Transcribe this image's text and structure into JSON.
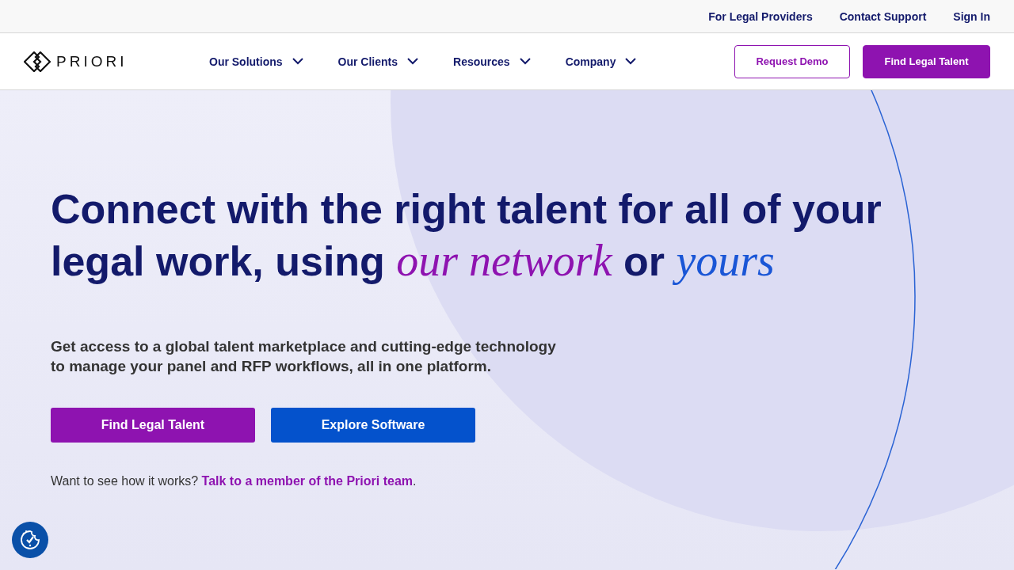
{
  "top_bar": {
    "links": [
      "For Legal Providers",
      "Contact Support",
      "Sign In"
    ]
  },
  "nav": {
    "logo": "PRIORI",
    "menu": [
      "Our Solutions",
      "Our Clients",
      "Resources",
      "Company"
    ],
    "buttons": [
      {
        "label": "Request Demo",
        "kind": "outline"
      },
      {
        "label": "Find Legal Talent",
        "kind": "filled"
      }
    ]
  },
  "hero": {
    "headline": [
      {
        "text": "Connect with the right talent for all of your legal work, using ",
        "kind": "plain"
      },
      {
        "text": "our network",
        "kind": "accent"
      },
      {
        "text": " or ",
        "kind": "plain"
      },
      {
        "text": "yours",
        "kind": "accent2"
      }
    ],
    "subtitle": "Get access to a global talent marketplace and cutting-edge technology to manage your panel and RFP workflows, all in one platform.",
    "buttons": [
      {
        "label": "Find Legal Talent",
        "kind": "purple"
      },
      {
        "label": "Explore Software",
        "kind": "blue"
      }
    ],
    "prompt": "Want to see how it works? ",
    "link": "Talk to a member of the Priori team",
    "end": "."
  }
}
